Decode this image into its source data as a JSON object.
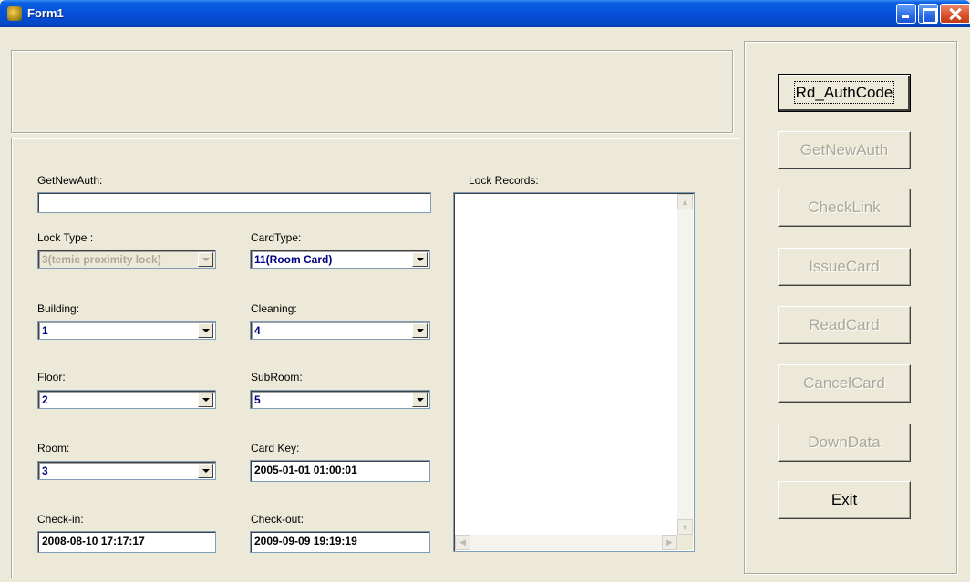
{
  "window": {
    "title": "Form1"
  },
  "form": {
    "getnewauth_label": "GetNewAuth:",
    "getnewauth_value": "",
    "lock_type_label": "Lock Type :",
    "lock_type_value": "3(temic proximity lock)",
    "card_type_label": "CardType:",
    "card_type_value": "11(Room Card)",
    "building_label": "Building:",
    "building_value": "1",
    "cleaning_label": "Cleaning:",
    "cleaning_value": "4",
    "floor_label": "Floor:",
    "floor_value": "2",
    "subroom_label": "SubRoom:",
    "subroom_value": "5",
    "room_label": "Room:",
    "room_value": "3",
    "card_key_label": "Card Key:",
    "card_key_value": "2005-01-01 01:00:01",
    "checkin_label": "Check-in:",
    "checkin_value": "2008-08-10 17:17:17",
    "checkout_label": "Check-out:",
    "checkout_value": "2009-09-09 19:19:19",
    "lock_records_label": "Lock Records:"
  },
  "buttons": {
    "rd_authcode": "Rd_AuthCode",
    "getnewauth": "GetNewAuth",
    "checklink": "CheckLink",
    "issuecard": "IssueCard",
    "readcard": "ReadCard",
    "cancelcard": "CancelCard",
    "downdata": "DownData",
    "exit": "Exit"
  },
  "colors": {
    "titlebar": "#0550d8",
    "window_bg": "#ece9d8",
    "combo_text": "#000080",
    "disabled_text": "#aca899"
  }
}
